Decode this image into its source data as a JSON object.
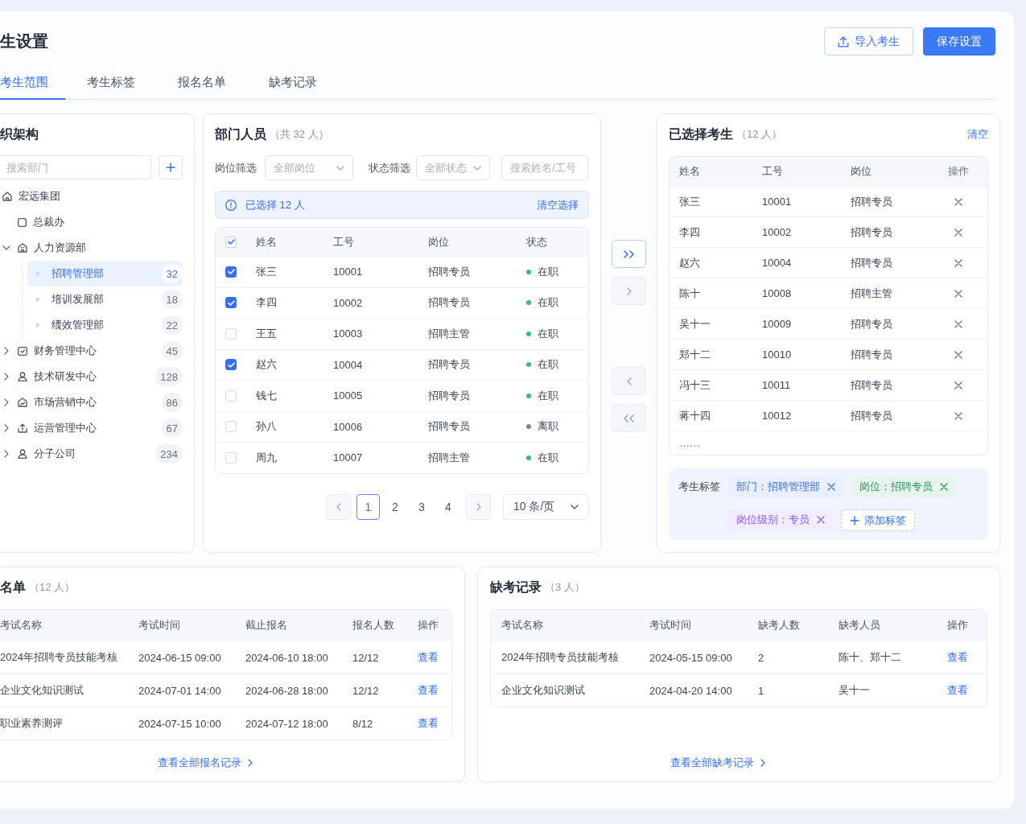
{
  "header": {
    "title": "生设置",
    "buttons": [
      {
        "label": "导入考生",
        "kind": "import"
      },
      {
        "label": "保存设置",
        "kind": "save"
      }
    ]
  },
  "tabs": [
    {
      "label": "考生范围",
      "selected": true
    },
    {
      "label": "考生标签",
      "selected": false
    },
    {
      "label": "报名名单",
      "selected": false
    },
    {
      "label": "缺考记录",
      "selected": false
    }
  ],
  "org_panel": {
    "title": "织架构",
    "search": {
      "placeholder": "搜索部门"
    },
    "tree": [
      {
        "label": "宏远集团",
        "kind": "group",
        "selected": false,
        "children": [
          {
            "label": "总裁办",
            "kind": "office",
            "selected": false
          },
          {
            "label": "人力资源部",
            "kind": "department",
            "expanded": true,
            "selected": false,
            "children": [
              {
                "label": "招聘管理部",
                "kind": "team",
                "count": "32",
                "selected": true
              },
              {
                "label": "培训发展部",
                "kind": "team",
                "count": "18",
                "selected": false
              },
              {
                "label": "绩效管理部",
                "kind": "team",
                "count": "22",
                "selected": false
              }
            ]
          },
          {
            "label": "财务管理中心",
            "kind": "finance",
            "expanded": false,
            "count": "45",
            "selected": false
          },
          {
            "label": "技术研发中心",
            "kind": "tech",
            "expanded": false,
            "count": "128",
            "selected": false
          },
          {
            "label": "市场营销中心",
            "kind": "marketing",
            "expanded": false,
            "count": "86",
            "selected": false
          },
          {
            "label": "运营管理中心",
            "kind": "operations",
            "expanded": false,
            "count": "67",
            "selected": false
          },
          {
            "label": "分子公司",
            "kind": "branch",
            "expanded": false,
            "count": "234",
            "selected": false
          }
        ]
      }
    ]
  },
  "member_panel": {
    "title": "部门人员",
    "count": "（共 32 人）",
    "filters": [
      {
        "label": "岗位筛选",
        "placeholder": "全部岗位"
      },
      {
        "label": "状态筛选",
        "placeholder": "全部状态"
      }
    ],
    "search": {
      "placeholder": "搜索姓名/工号"
    },
    "notice": {
      "text": "已选择 12 人",
      "action": "清空选择"
    },
    "table": {
      "select_all": {
        "checked": true
      },
      "columns": [
        "姓名",
        "工号",
        "岗位",
        "状态"
      ],
      "rows": [
        {
          "checked": true,
          "name": "张三",
          "id": "10001",
          "position": "招聘专员",
          "status": "在职",
          "color": "#34c06e"
        },
        {
          "checked": true,
          "name": "李四",
          "id": "10002",
          "position": "招聘专员",
          "status": "在职",
          "color": "#34c06e"
        },
        {
          "checked": false,
          "name": "王五",
          "id": "10003",
          "position": "招聘主管",
          "status": "在职",
          "color": "#34c06e"
        },
        {
          "checked": true,
          "name": "赵六",
          "id": "10004",
          "position": "招聘专员",
          "status": "在职",
          "color": "#34c06e"
        },
        {
          "checked": false,
          "name": "钱七",
          "id": "10005",
          "position": "招聘专员",
          "status": "在职",
          "color": "#34c06e"
        },
        {
          "checked": false,
          "name": "孙八",
          "id": "10006",
          "position": "招聘专员",
          "status": "离职",
          "color": "#7d8596"
        },
        {
          "checked": false,
          "name": "周九",
          "id": "10007",
          "position": "招聘主管",
          "status": "在职",
          "color": "#34c06e"
        }
      ]
    },
    "pagination": {
      "pages": [
        {
          "label": "1",
          "selected": true
        },
        {
          "label": "2",
          "selected": false
        },
        {
          "label": "3",
          "selected": false
        },
        {
          "label": "4",
          "selected": false
        }
      ],
      "page_size": "10 条/页"
    }
  },
  "transfer_buttons": [
    {
      "kind": "move_all_right",
      "disabled": false
    },
    {
      "kind": "move_right",
      "disabled": true
    },
    {
      "kind": "move_left",
      "disabled": true
    },
    {
      "kind": "move_all_left",
      "disabled": true
    }
  ],
  "selected_panel": {
    "title": "已选择考生",
    "count": "（12 人）",
    "action": "清空",
    "table": {
      "columns": [
        "姓名",
        "工号",
        "岗位",
        "操作"
      ],
      "rows": [
        {
          "name": "张三",
          "id": "10001",
          "position": "招聘专员"
        },
        {
          "name": "李四",
          "id": "10002",
          "position": "招聘专员"
        },
        {
          "name": "赵六",
          "id": "10004",
          "position": "招聘专员"
        },
        {
          "name": "陈十",
          "id": "10008",
          "position": "招聘主管"
        },
        {
          "name": "吴十一",
          "id": "10009",
          "position": "招聘专员"
        },
        {
          "name": "郑十二",
          "id": "10010",
          "position": "招聘专员"
        },
        {
          "name": "冯十三",
          "id": "10011",
          "position": "招聘专员"
        },
        {
          "name": "蒋十四",
          "id": "10012",
          "position": "招聘专员"
        }
      ],
      "more": "……"
    },
    "tags": {
      "label": "考生标签",
      "items": [
        {
          "label": "部门：招聘管理部",
          "color": "#3370ff"
        },
        {
          "label": "岗位：招聘专员",
          "color": "#1f9d57"
        },
        {
          "label": "岗位级别：专员",
          "color": "#8b5cf6"
        }
      ],
      "add_label": "添加标签"
    }
  },
  "registration_panel": {
    "title": "名单",
    "count": "（12 人）",
    "table": {
      "columns": [
        "考试名称",
        "考试时间",
        "截止报名",
        "报名人数",
        "操作"
      ],
      "rows": [
        {
          "cells": [
            "2024年招聘专员技能考核",
            "2024-06-15 09:00",
            "2024-06-10 18:00",
            "12/12"
          ],
          "action": "查看"
        },
        {
          "cells": [
            "企业文化知识测试",
            "2024-07-01 14:00",
            "2024-06-28 18:00",
            "12/12"
          ],
          "action": "查看"
        },
        {
          "cells": [
            "职业素养测评",
            "2024-07-15 10:00",
            "2024-07-12 18:00",
            "8/12"
          ],
          "action": "查看"
        }
      ]
    },
    "footer_link": "查看全部报名记录"
  },
  "absence_panel": {
    "title": "缺考记录",
    "count": "（3 人）",
    "table": {
      "columns": [
        "考试名称",
        "考试时间",
        "缺考人数",
        "缺考人员",
        "操作"
      ],
      "rows": [
        {
          "cells": [
            "2024年招聘专员技能考核",
            "2024-05-15 09:00",
            "2",
            "陈十、郑十二"
          ],
          "action": "查看"
        },
        {
          "cells": [
            "企业文化知识测试",
            "2024-04-20 14:00",
            "1",
            "吴十一"
          ],
          "action": "查看"
        }
      ]
    },
    "footer_link": "查看全部缺考记录"
  }
}
